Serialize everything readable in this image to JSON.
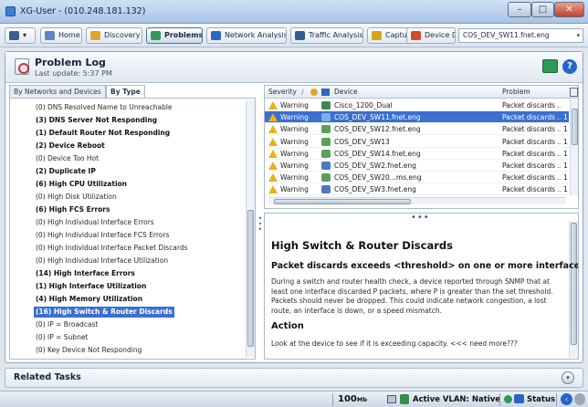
{
  "window": {
    "title": "XG-User - (010.248.181.132)",
    "minimize": "–",
    "maximize": "□",
    "close": "✕"
  },
  "toolbar": {
    "menu": "▾",
    "home": "Home",
    "discovery": "Discovery",
    "problems": "Problems",
    "network_analysis": "Network Analysis",
    "traffic_analysis": "Traffic Analysis",
    "capture": "Capture",
    "device_detail": "Device Detail",
    "device_selected": "COS_DEV_SW11.fnet.eng",
    "close_x": "×",
    "dropdown": "▾"
  },
  "panel": {
    "title": "Problem Log",
    "subtitle": "Last update: 5:37 PM",
    "help": "?"
  },
  "left_tabs": [
    "By Networks and Devices",
    "By Type"
  ],
  "tree_items": [
    {
      "label": "(0) DNS Resolved Name to Unreachable",
      "bold": false
    },
    {
      "label": "(3) DNS Server Not Responding",
      "bold": true
    },
    {
      "label": "(1) Default Router Not Responding",
      "bold": true
    },
    {
      "label": "(2) Device Reboot",
      "bold": true
    },
    {
      "label": "(0) Device Too Hot",
      "bold": false
    },
    {
      "label": "(2) Duplicate IP",
      "bold": true
    },
    {
      "label": "(6) High CPU Utilization",
      "bold": true
    },
    {
      "label": "(0) High Disk Utilization",
      "bold": false
    },
    {
      "label": "(6) High FCS Errors",
      "bold": true
    },
    {
      "label": "(0) High Individual Interface Errors",
      "bold": false
    },
    {
      "label": "(0) High Individual Interface FCS Errors",
      "bold": false
    },
    {
      "label": "(0) High Individual Interface Packet Discards",
      "bold": false
    },
    {
      "label": "(0) High Individual Interface Utilization",
      "bold": false
    },
    {
      "label": "(14) High Interface Errors",
      "bold": true
    },
    {
      "label": "(1) High Interface Utilization",
      "bold": true
    },
    {
      "label": "(4) High Memory Utilization",
      "bold": true
    },
    {
      "label": "(16) High Switch & Router Discards",
      "bold": true,
      "selected": true
    },
    {
      "label": "(0) IP = Broadcast",
      "bold": false
    },
    {
      "label": "(0) IP = Subnet",
      "bold": false
    },
    {
      "label": "(0) Key Device Not Responding",
      "bold": false
    }
  ],
  "grid": {
    "columns": [
      "Severity",
      "Device",
      "Problem"
    ],
    "sort_arrow": "∕",
    "rows": [
      {
        "severity": "Warning",
        "device": "Cisco_1200_Dual",
        "problem": "Packet discards ...",
        "icon_color": "#3b8a50",
        "extra": ""
      },
      {
        "severity": "Warning",
        "device": "COS_DEV_SW11.fnet.eng",
        "problem": "Packet discards ...",
        "icon_color": "#7ab0e8",
        "extra": "1",
        "selected": true
      },
      {
        "severity": "Warning",
        "device": "COS_DEV_SW12.fnet.eng",
        "problem": "Packet discards ...",
        "icon_color": "#5aa05a",
        "extra": "1"
      },
      {
        "severity": "Warning",
        "device": "COS_DEV_SW13",
        "problem": "Packet discards ...",
        "icon_color": "#5aa05a",
        "extra": "1"
      },
      {
        "severity": "Warning",
        "device": "COS_DEV_SW14.fnet.eng",
        "problem": "Packet discards ...",
        "icon_color": "#5aa05a",
        "extra": "1"
      },
      {
        "severity": "Warning",
        "device": "COS_DEV_SW2.fnet.eng",
        "problem": "Packet discards ...",
        "icon_color": "#4a79c0",
        "extra": "1"
      },
      {
        "severity": "Warning",
        "device": "COS_DEV_SW20...ms.eng",
        "problem": "Packet discards ...",
        "icon_color": "#5aa05a",
        "extra": "1"
      },
      {
        "severity": "Warning",
        "device": "COS_DEV_SW3.fnet.eng",
        "problem": "Packet discards ...",
        "icon_color": "#4a79c0",
        "extra": "1"
      }
    ]
  },
  "detail": {
    "handle": "•••",
    "title": "High Switch & Router Discards",
    "subtitle": "Packet discards exceeds <threshold> on one or more interfaces",
    "description": "During a switch and router health check, a device reported through SNMP that at least one interface discarded P packets, where P is greater than the set threshold. Packets should never be dropped. This could indicate network congestion, a lost route, an interface is down, or a speed mismatch.",
    "action_heading": "Action",
    "action_text": "Look at the device to see if it is exceeding capacity. <<< need more???"
  },
  "related": {
    "title": "Related Tasks",
    "expand": "▾"
  },
  "statusbar": {
    "speed": "100",
    "speed_unit": "Mb",
    "vlan": "Active VLAN: Native",
    "status": "Status",
    "nav": "‹"
  }
}
